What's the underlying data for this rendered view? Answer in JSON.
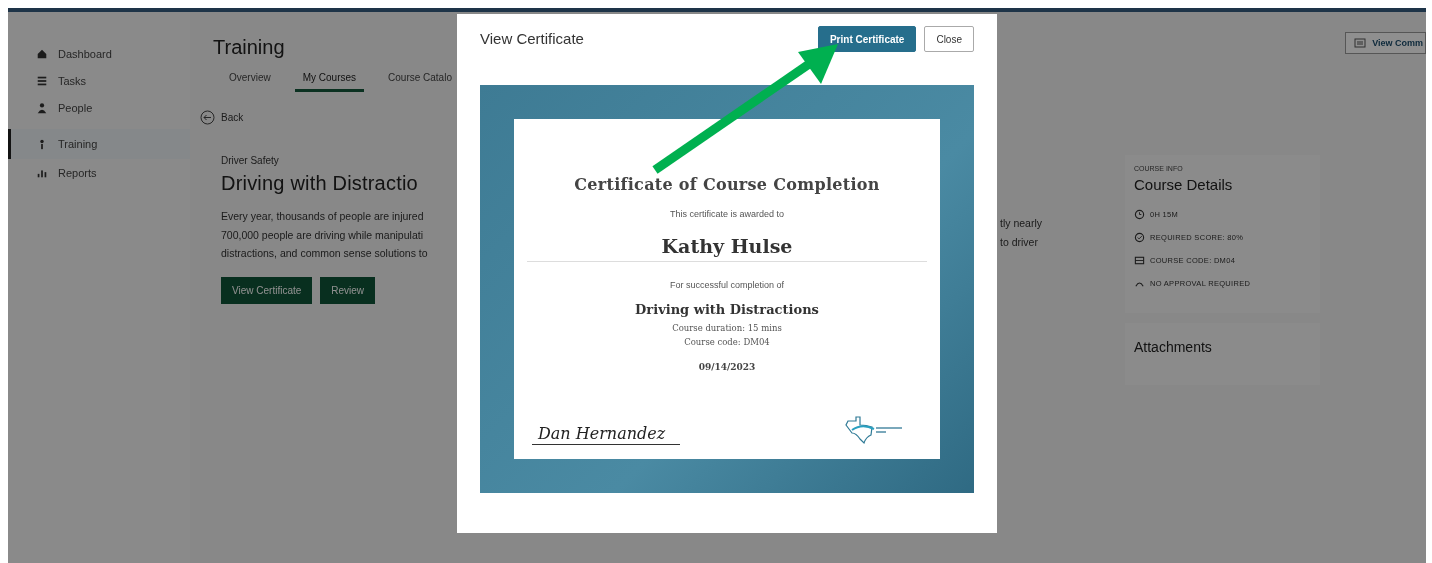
{
  "sidebar": {
    "items": [
      {
        "label": "Dashboard",
        "selected": false
      },
      {
        "label": "Tasks",
        "selected": false
      },
      {
        "label": "People",
        "selected": false
      },
      {
        "label": "Training",
        "selected": true
      },
      {
        "label": "Reports",
        "selected": false
      }
    ]
  },
  "header": {
    "title": "Training",
    "action_button": "View Comm"
  },
  "tabs": [
    {
      "label": "Overview",
      "selected": false
    },
    {
      "label": "My Courses",
      "selected": true
    },
    {
      "label": "Course Catalo",
      "selected": false
    }
  ],
  "back_link": "Back",
  "course": {
    "category": "Driver Safety",
    "title": "Driving with Distractio",
    "description_lines": [
      "Every year, thousands of people are injured",
      "700,000 people are driving while manipulati",
      "distractions, and common sense solutions to"
    ],
    "description_fragments": [
      "tly nearly",
      "to driver"
    ],
    "buttons": [
      "View Certificate",
      "Review"
    ]
  },
  "course_info": {
    "eyebrow": "COURSE INFO",
    "title": "Course Details",
    "items": [
      {
        "kind": "duration",
        "text": "0H 15M"
      },
      {
        "kind": "score",
        "text": "REQUIRED SCORE: 80%"
      },
      {
        "kind": "code",
        "text": "COURSE CODE: DM04"
      },
      {
        "kind": "approval",
        "text": "NO APPROVAL REQUIRED"
      }
    ]
  },
  "attachments": {
    "title": "Attachments"
  },
  "modal": {
    "title": "View Certificate",
    "buttons": [
      {
        "label": "Print Certificate",
        "kind": "primary"
      },
      {
        "label": "Close",
        "kind": "secondary"
      }
    ],
    "certificate": {
      "heading": "Certificate of Course Completion",
      "awarded_text": "This certificate is awarded to",
      "recipient": "Kathy Hulse",
      "completion_text": "For successful completion of",
      "course_name": "Driving with Distractions",
      "duration": "Course duration: 15 mins",
      "code": "Course code: DM04",
      "date": "09/14/2023",
      "signature": "Dan Hernandez"
    }
  }
}
